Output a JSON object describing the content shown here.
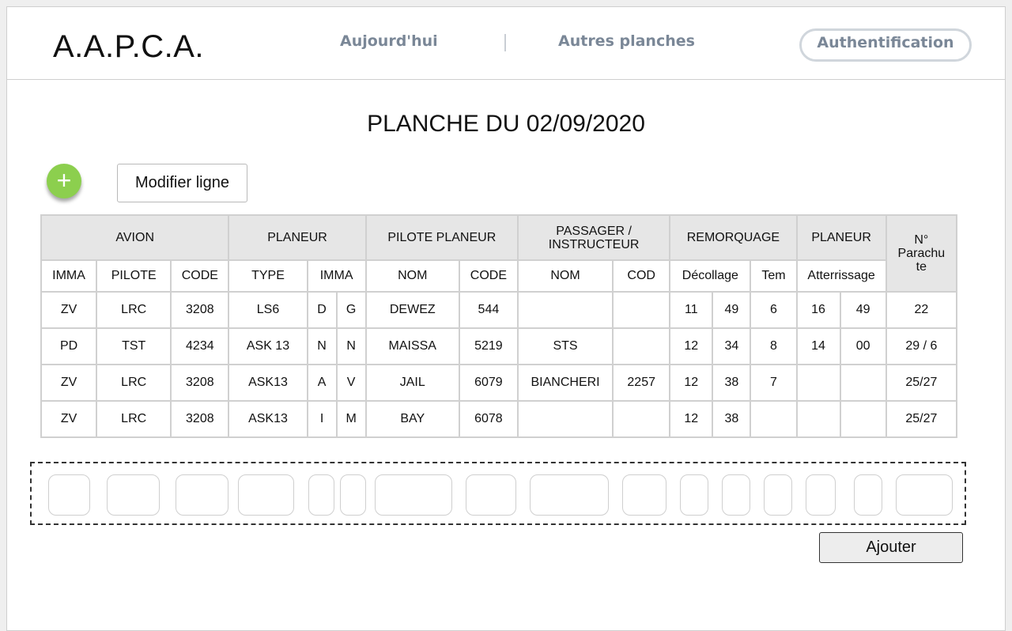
{
  "header": {
    "logo": "A.A.P.C.A.",
    "nav_today": "Aujourd'hui",
    "nav_other": "Autres planches",
    "auth": "Authentification"
  },
  "page_title": "PLANCHE DU 02/09/2020",
  "toolbar": {
    "add_icon": "+",
    "modify_label": "Modifier ligne"
  },
  "table": {
    "groups": {
      "avion": "AVION",
      "planeur": "PLANEUR",
      "pilote_planeur": "PILOTE PLANEUR",
      "passager_line1": "PASSAGER /",
      "passager_line2": "INSTRUCTEUR",
      "remorquage": "REMORQUAGE",
      "planeur2": "PLANEUR",
      "parachute_line1": "N°",
      "parachute_line2": "Parachu",
      "parachute_line3": "te"
    },
    "subheaders": {
      "imma": "IMMA",
      "pilote": "PILOTE",
      "code": "CODE",
      "type": "TYPE",
      "imma2": "IMMA",
      "nom": "NOM",
      "code2": "CODE",
      "nom2": "NOM",
      "cod": "COD",
      "decollage": "Décollage",
      "tem": "Tem",
      "atterrissage": "Atterrissage"
    },
    "rows": [
      [
        "ZV",
        "LRC",
        "3208",
        "LS6",
        "D",
        "G",
        "DEWEZ",
        "544",
        "",
        "",
        "11",
        "49",
        "6",
        "16",
        "49",
        "22"
      ],
      [
        "PD",
        "TST",
        "4234",
        "ASK 13",
        "N",
        "N",
        "MAISSA",
        "5219",
        "STS",
        "",
        "12",
        "34",
        "8",
        "14",
        "00",
        "29 / 6"
      ],
      [
        "ZV",
        "LRC",
        "3208",
        "ASK13",
        "A",
        "V",
        "JAIL",
        "6079",
        "BIANCHERI",
        "2257",
        "12",
        "38",
        "7",
        "",
        "",
        "25/27"
      ],
      [
        "ZV",
        "LRC",
        "3208",
        "ASK13",
        "I",
        "M",
        "BAY",
        "6078",
        "",
        "",
        "12",
        "38",
        "",
        "",
        "",
        "25/27"
      ]
    ]
  },
  "add_button": "Ajouter",
  "colors": {
    "accent_green": "#8ccf4e",
    "nav_gray": "#7a8797",
    "header_gray": "#e6e6e6"
  }
}
